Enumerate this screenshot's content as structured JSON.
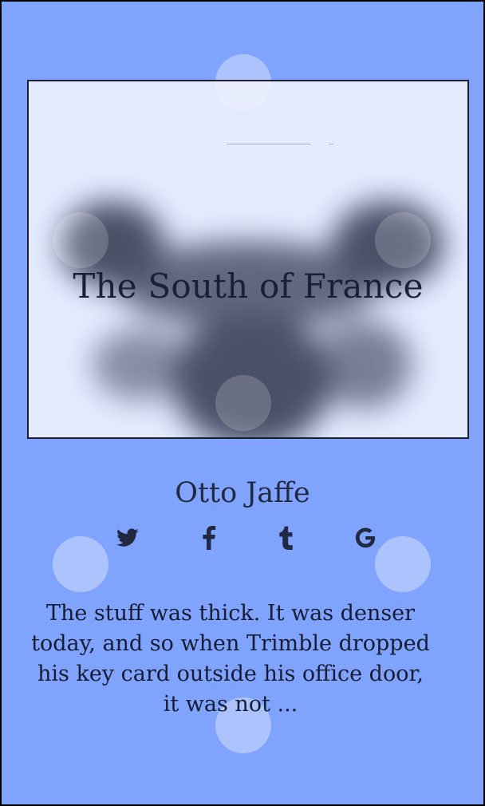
{
  "book": {
    "title": "The South of France",
    "author": "Otto Jaffe",
    "excerpt": "The stuff was thick. It was denser today, and so when Trimble dropped his key card outside his office door, it was not ..."
  },
  "share": {
    "icons": [
      "twitter-icon",
      "facebook-icon",
      "tumblr-icon",
      "google-icon"
    ]
  },
  "colors": {
    "background": "#80a3fe",
    "frame": "#000000",
    "cover_background": "#e4ebff",
    "cover_shadow": "#4a5068",
    "text": "#1c2036"
  }
}
